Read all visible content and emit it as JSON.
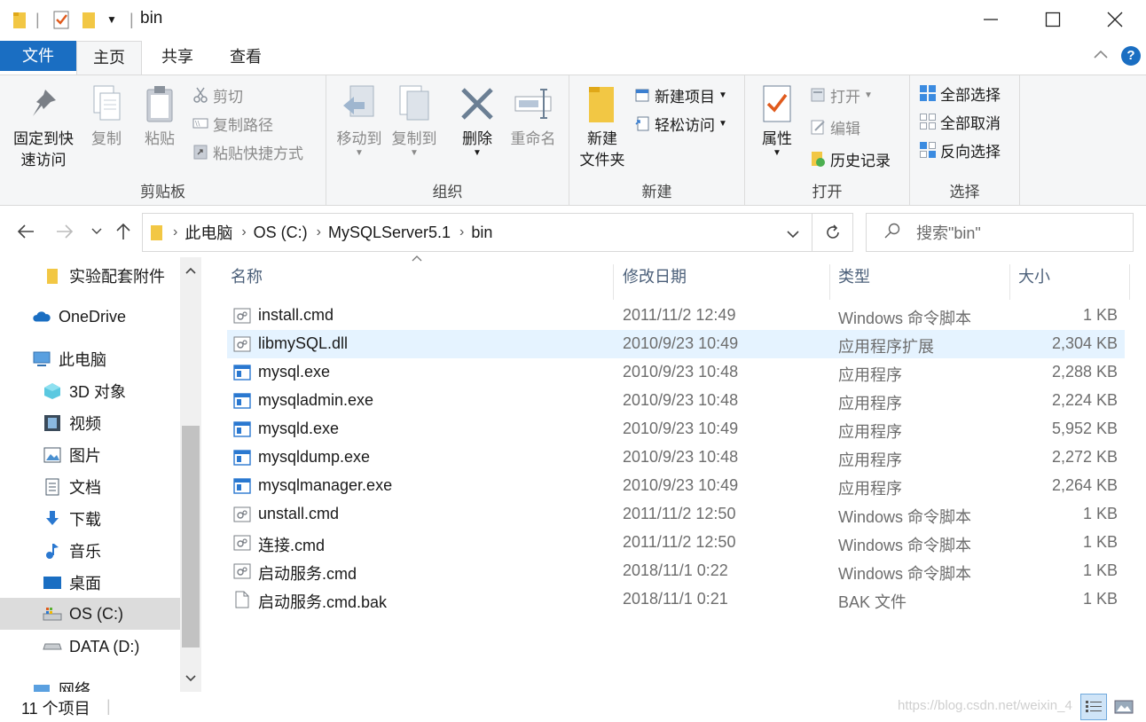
{
  "window": {
    "title": "bin"
  },
  "ribbon_tabs": [
    {
      "label": "文件"
    },
    {
      "label": "主页"
    },
    {
      "label": "共享"
    },
    {
      "label": "查看"
    }
  ],
  "ribbon": {
    "clipboard": {
      "label": "剪贴板",
      "pin_line1": "固定到快",
      "pin_line2": "速访问",
      "copy": "复制",
      "paste": "粘贴",
      "cut": "剪切",
      "copy_path": "复制路径",
      "paste_shortcut": "粘贴快捷方式"
    },
    "organize": {
      "label": "组织",
      "move_to": "移动到",
      "copy_to": "复制到",
      "delete": "删除",
      "rename": "重命名"
    },
    "new": {
      "label": "新建",
      "new_folder_line1": "新建",
      "new_folder_line2": "文件夹",
      "new_item": "新建项目",
      "easy_access": "轻松访问"
    },
    "open": {
      "label": "打开",
      "properties": "属性",
      "open": "打开",
      "edit": "编辑",
      "history": "历史记录"
    },
    "select": {
      "label": "选择",
      "select_all": "全部选择",
      "select_none": "全部取消",
      "invert": "反向选择"
    }
  },
  "address": {
    "segments": [
      "此电脑",
      "OS (C:)",
      "MySQLServer5.1",
      "bin"
    ],
    "search_placeholder": "搜索\"bin\""
  },
  "nav_pane": {
    "items": [
      {
        "label": "实验配套附件",
        "icon": "folder-icon"
      },
      {
        "label": "OneDrive",
        "icon": "cloud-icon"
      },
      {
        "label": "此电脑",
        "icon": "computer-icon"
      },
      {
        "label": "3D 对象",
        "icon": "cube-icon"
      },
      {
        "label": "视频",
        "icon": "video-icon"
      },
      {
        "label": "图片",
        "icon": "picture-icon"
      },
      {
        "label": "文档",
        "icon": "document-icon"
      },
      {
        "label": "下载",
        "icon": "download-icon"
      },
      {
        "label": "音乐",
        "icon": "music-icon"
      },
      {
        "label": "桌面",
        "icon": "desktop-icon"
      },
      {
        "label": "OS (C:)",
        "icon": "drive-c-icon"
      },
      {
        "label": "DATA (D:)",
        "icon": "drive-d-icon"
      },
      {
        "label": "网络",
        "icon": "network-icon"
      }
    ]
  },
  "file_list": {
    "columns": [
      "名称",
      "修改日期",
      "类型",
      "大小"
    ],
    "rows": [
      {
        "name": "install.cmd",
        "date": "2011/11/2 12:49",
        "type": "Windows 命令脚本",
        "size": "1 KB",
        "icon": "script-icon"
      },
      {
        "name": "libmySQL.dll",
        "date": "2010/9/23 10:49",
        "type": "应用程序扩展",
        "size": "2,304 KB",
        "icon": "dll-icon"
      },
      {
        "name": "mysql.exe",
        "date": "2010/9/23 10:48",
        "type": "应用程序",
        "size": "2,288 KB",
        "icon": "exe-icon"
      },
      {
        "name": "mysqladmin.exe",
        "date": "2010/9/23 10:48",
        "type": "应用程序",
        "size": "2,224 KB",
        "icon": "exe-icon"
      },
      {
        "name": "mysqld.exe",
        "date": "2010/9/23 10:49",
        "type": "应用程序",
        "size": "5,952 KB",
        "icon": "exe-icon"
      },
      {
        "name": "mysqldump.exe",
        "date": "2010/9/23 10:48",
        "type": "应用程序",
        "size": "2,272 KB",
        "icon": "exe-icon"
      },
      {
        "name": "mysqlmanager.exe",
        "date": "2010/9/23 10:49",
        "type": "应用程序",
        "size": "2,264 KB",
        "icon": "exe-icon"
      },
      {
        "name": "unstall.cmd",
        "date": "2011/11/2 12:50",
        "type": "Windows 命令脚本",
        "size": "1 KB",
        "icon": "script-icon"
      },
      {
        "name": "连接.cmd",
        "date": "2011/11/2 12:50",
        "type": "Windows 命令脚本",
        "size": "1 KB",
        "icon": "script-icon"
      },
      {
        "name": "启动服务.cmd",
        "date": "2018/11/1 0:22",
        "type": "Windows 命令脚本",
        "size": "1 KB",
        "icon": "script-icon"
      },
      {
        "name": "启动服务.cmd.bak",
        "date": "2018/11/1 0:21",
        "type": "BAK 文件",
        "size": "1 KB",
        "icon": "blank-file-icon"
      }
    ]
  },
  "status": {
    "item_count": "11 个项目",
    "watermark": "https://blog.csdn.net/weixin_4"
  },
  "colors": {
    "accent": "#1a6ec2",
    "hover_row": "#e5f3ff"
  }
}
